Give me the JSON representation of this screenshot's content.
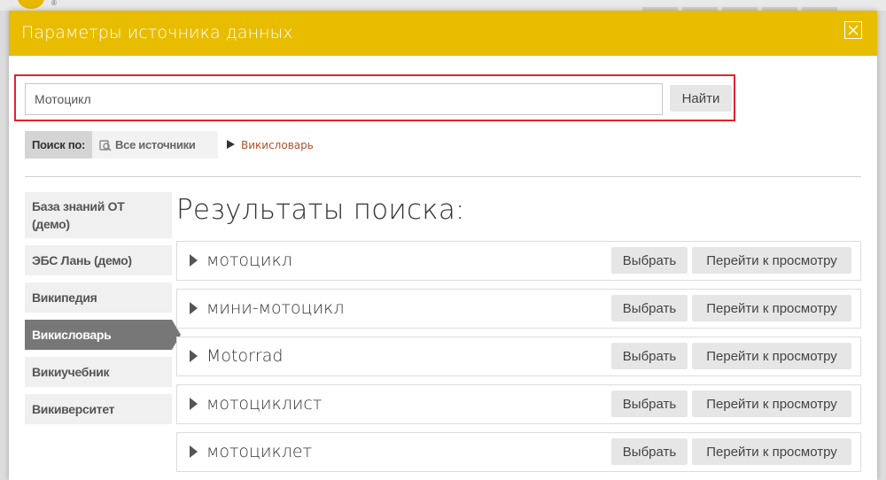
{
  "modal": {
    "title": "Параметры источника данных"
  },
  "search": {
    "value": "Мотоцикл",
    "button_label": "Найти"
  },
  "search_by": {
    "label": "Поиск по:",
    "all_sources": "Все источники",
    "current": "Викисловарь"
  },
  "sidebar": {
    "items": [
      {
        "label": "База знаний ОТ (демо)"
      },
      {
        "label": "ЭБС Лань (демо)"
      },
      {
        "label": "Википедия"
      },
      {
        "label": "Викисловарь"
      },
      {
        "label": "Викиучебник"
      },
      {
        "label": "Викиверситет"
      }
    ],
    "active_index": 3
  },
  "results": {
    "heading": "Результаты поиска:",
    "select_label": "Выбрать",
    "view_label": "Перейти к просмотру",
    "items": [
      {
        "title": "мотоцикл"
      },
      {
        "title": "мини-мотоцикл"
      },
      {
        "title": "Motorrad"
      },
      {
        "title": "мотоциклист"
      },
      {
        "title": "мотоциклет"
      }
    ]
  },
  "colors": {
    "header": "#e8bd00",
    "highlight_border": "#e3222a",
    "active_sidebar": "#777777",
    "link": "#b4502a"
  }
}
